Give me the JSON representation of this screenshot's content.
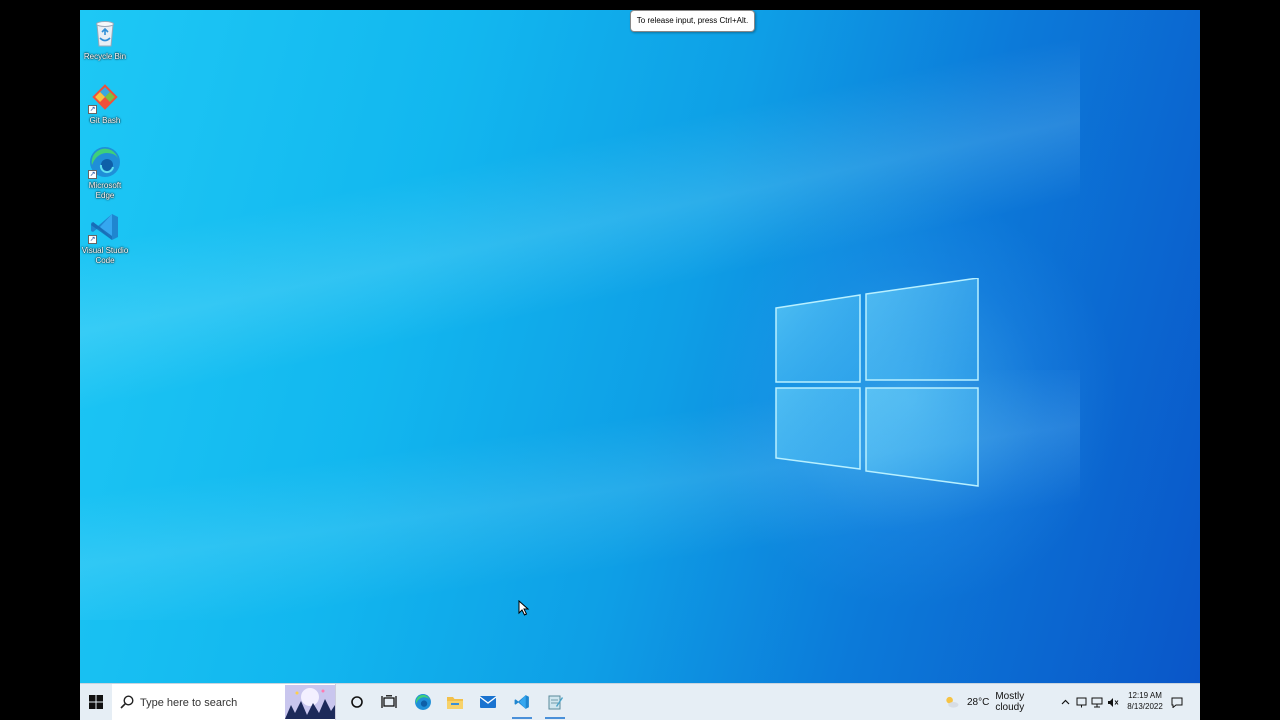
{
  "desktop": {
    "icons": [
      {
        "label": "Recycle Bin",
        "icon": "recycle-bin-icon"
      },
      {
        "label": "Git Bash",
        "icon": "git-bash-icon"
      },
      {
        "label": "Microsoft Edge",
        "icon": "edge-icon"
      },
      {
        "label": "Visual Studio Code",
        "icon": "vscode-icon"
      }
    ]
  },
  "tooltip": {
    "text": "To release input, press Ctrl+Alt."
  },
  "taskbar": {
    "search_placeholder": "Type here to search",
    "pinned": [
      "cortana-icon",
      "task-view-icon",
      "edge-icon",
      "file-explorer-icon",
      "mail-icon",
      "vscode-icon",
      "notepad-icon"
    ],
    "weather": {
      "temp": "28°C",
      "condition": "Mostly cloudy"
    },
    "clock": {
      "time": "12:19 AM",
      "date": "8/13/2022"
    }
  },
  "colors": {
    "accent": "#0078d4",
    "taskbar_bg": "#e6eef5"
  }
}
